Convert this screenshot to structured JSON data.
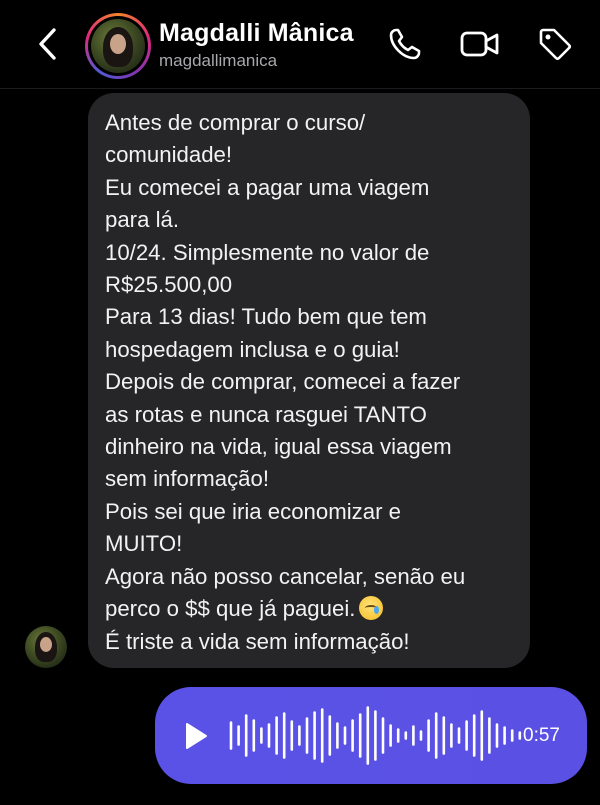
{
  "header": {
    "contact_name": "Magdalli Mânica",
    "username": "magdallimanica",
    "icons": [
      "back-chevron-icon",
      "phone-icon",
      "video-camera-icon",
      "tag-icon"
    ]
  },
  "message": {
    "lines": [
      "Antes de comprar o curso/",
      "comunidade!",
      "Eu comecei a pagar uma viagem",
      "para lá.",
      "10/24. Simplesmente no valor de",
      "R$25.500,00",
      "Para 13 dias! Tudo bem que tem",
      "hospedagem inclusa e o guia!",
      "Depois de comprar, comecei a fazer",
      "as rotas e nunca rasguei TANTO",
      "dinheiro na vida, igual essa viagem",
      "sem informação!",
      "Pois sei que iria economizar e",
      "MUITO!",
      "Agora não posso cancelar, senão eu",
      "perco o $$ que já paguei.",
      "É triste a vida sem informação!"
    ],
    "emoji": "crying-face-with-tear"
  },
  "voice_message": {
    "duration": "0:57",
    "colors": {
      "background": "#5b52e6"
    }
  },
  "colors": {
    "background": "#000000",
    "bubble": "#262628",
    "secondary_text": "#a8a8ad"
  }
}
